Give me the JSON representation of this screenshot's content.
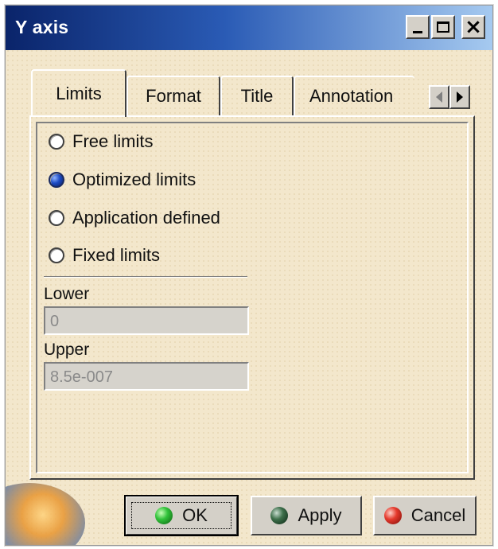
{
  "window": {
    "title": "Y axis",
    "titlebar_colors": {
      "start": "#0a246a",
      "end": "#a6caf0"
    },
    "background": "#f3e7cc"
  },
  "tabs": [
    {
      "label": "Limits",
      "active": true
    },
    {
      "label": "Format",
      "active": false
    },
    {
      "label": "Title",
      "active": false
    },
    {
      "label": "Annotation",
      "active": false
    }
  ],
  "tab_scroll": {
    "left_icon": "arrow-left-icon",
    "right_icon": "arrow-right-icon"
  },
  "limits": {
    "options": [
      {
        "label": "Free limits",
        "checked": false
      },
      {
        "label": "Optimized limits",
        "checked": true
      },
      {
        "label": "Application defined",
        "checked": false
      },
      {
        "label": "Fixed limits",
        "checked": false
      }
    ],
    "lower_label": "Lower",
    "lower_value": "0",
    "upper_label": "Upper",
    "upper_value": "8.5e-007"
  },
  "buttons": {
    "ok": "OK",
    "apply": "Apply",
    "cancel": "Cancel"
  }
}
